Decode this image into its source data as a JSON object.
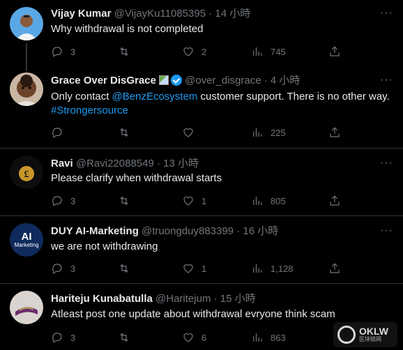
{
  "tweets": [
    {
      "name": "Vijay Kumar",
      "handle": "@VijayKu11085395",
      "time": "· 14 小時",
      "text": "Why withdrawal is not completed",
      "replies": "3",
      "retweets": "",
      "likes": "2",
      "views": "745"
    },
    {
      "name": "Grace Over DisGrace",
      "handle": "@over_disgrace",
      "time": "· 4 小時",
      "text_pre": "Only contact ",
      "mention": "@BenzEcosystem",
      "text_post": " customer support. There is no other way.",
      "hashtag": "#Strongersource",
      "replies": "",
      "retweets": "",
      "likes": "",
      "views": "225"
    },
    {
      "name": "Ravi",
      "handle": "@Ravi22088549",
      "time": "· 13 小時",
      "text": "Please clarify when withdrawal starts",
      "replies": "3",
      "retweets": "",
      "likes": "1",
      "views": "805"
    },
    {
      "name": "DUY AI-Marketing",
      "handle": "@truongduy883399",
      "time": "· 16 小時",
      "text": "we are not withdrawing",
      "avatar_text": "AI",
      "avatar_sub": "Marketing",
      "replies": "3",
      "retweets": "",
      "likes": "1",
      "views": "1,128"
    },
    {
      "name": "Hariteju Kunabatulla",
      "handle": "@Haritejum",
      "time": "· 15 小時",
      "text": "Atleast post one update about withdrawal evryone think scam",
      "replies": "3",
      "retweets": "",
      "likes": "6",
      "views": "863"
    }
  ],
  "more_label": "···",
  "watermark": {
    "title": "OKLW",
    "subtitle": "区块链网"
  },
  "colors": {
    "background": "#000000",
    "text": "#e7e9ea",
    "muted": "#71767b",
    "link": "#1d9bf0",
    "divider": "#2f3336"
  },
  "icons": [
    "reply-icon",
    "retweet-icon",
    "like-icon",
    "views-icon",
    "share-icon",
    "verified-badge-icon"
  ]
}
